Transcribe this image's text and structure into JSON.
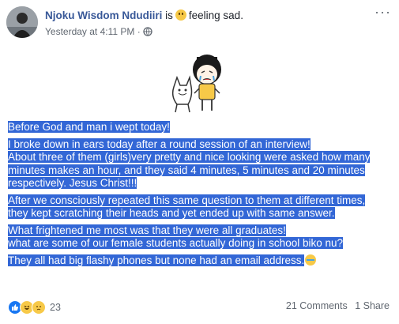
{
  "post": {
    "author": "Njoku Wisdom Ndudiiri",
    "is_text": "is",
    "feeling_text": "feeling sad.",
    "timestamp": "Yesterday at 4:11 PM",
    "separator": "·",
    "privacy_icon": "globe-icon",
    "menu_label": "···",
    "paragraphs": [
      "Before God and man i wept today!",
      "I broke down in ears today after a round session of an interview!\nAbout three of them (girls)very pretty and nice looking were asked how many minutes makes an hour, and they said 4 minutes, 5 minutes and 20 minutes respectively. Jesus Christ!!!",
      "After we consciously repeated this same question to them at different times, they kept scratching their heads and yet ended up with same answer.",
      "What frightened me most was that they were all graduates!\nwhat are some of our female students actually doing in school biko nu?",
      "They all had big flashy phones but none had an email address."
    ]
  },
  "footer": {
    "reaction_icons": [
      "like-icon",
      "haha-icon",
      "sad-icon"
    ],
    "reaction_count": "23",
    "comments": "21 Comments",
    "shares": "1 Share"
  },
  "colors": {
    "author_link": "#385898",
    "selection_highlight": "#3367d6",
    "meta_text": "#606770"
  }
}
